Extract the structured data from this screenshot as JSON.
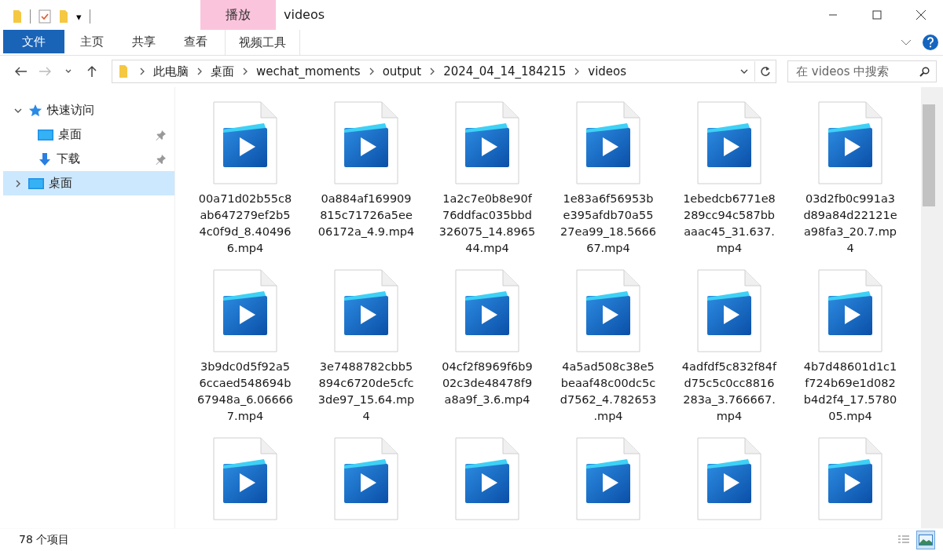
{
  "quick_access_toolbar": {
    "dropdown": "▾"
  },
  "title": "videos",
  "context_tab": {
    "group": "播放",
    "label": "视频工具"
  },
  "ribbon_tabs": [
    {
      "label": "文件",
      "selected": true,
      "kind": "file"
    },
    {
      "label": "主页",
      "selected": false,
      "kind": "tab"
    },
    {
      "label": "共享",
      "selected": false,
      "kind": "tab"
    },
    {
      "label": "查看",
      "selected": false,
      "kind": "tab"
    }
  ],
  "address": {
    "path": [
      "此电脑",
      "桌面",
      "wechat_moments",
      "output",
      "2024_04_14_184215",
      "videos"
    ]
  },
  "search": {
    "placeholder": "在 videos 中搜索"
  },
  "sidebar": {
    "items": [
      {
        "label": "快速访问",
        "kind": "quick_access",
        "expanded": true,
        "selected": false,
        "children": [
          {
            "label": "桌面",
            "kind": "desktop",
            "pinned": true,
            "selected": false
          },
          {
            "label": "下载",
            "kind": "download",
            "pinned": true,
            "selected": false
          }
        ]
      },
      {
        "label": "桌面",
        "kind": "desktop",
        "expanded": false,
        "selected": true
      }
    ]
  },
  "files": [
    {
      "kind": "labeled",
      "name_lines": [
        "00a71d02b55c8",
        "ab647279ef2b5",
        "4c0f9d_8.40496",
        "6.mp4"
      ]
    },
    {
      "kind": "labeled",
      "name_lines": [
        "0a884af169909",
        "815c71726a5ee",
        "06172a_4.9.mp4"
      ]
    },
    {
      "kind": "labeled",
      "name_lines": [
        "1a2c7e0b8e90f",
        "76ddfac035bbd",
        "326075_14.8965",
        "44.mp4"
      ]
    },
    {
      "kind": "labeled",
      "name_lines": [
        "1e83a6f56953b",
        "e395afdb70a55",
        "27ea99_18.5666",
        "67.mp4"
      ]
    },
    {
      "kind": "labeled",
      "name_lines": [
        "1ebedcb6771e8",
        "289cc94c587bb",
        "aaac45_31.637.",
        "mp4"
      ]
    },
    {
      "kind": "labeled",
      "name_lines": [
        "03d2fb0c991a3",
        "d89a84d22121e",
        "a98fa3_20.7.mp",
        "4"
      ]
    },
    {
      "kind": "labeled",
      "name_lines": [
        "3b9dc0d5f92a5",
        "6ccaed548694b",
        "67948a_6.06666",
        "7.mp4"
      ]
    },
    {
      "kind": "labeled",
      "name_lines": [
        "3e7488782cbb5",
        "894c6720de5cfc",
        "3de97_15.64.mp",
        "4"
      ]
    },
    {
      "kind": "labeled",
      "name_lines": [
        "04cf2f8969f6b9",
        "02c3de48478f9",
        "a8a9f_3.6.mp4"
      ]
    },
    {
      "kind": "labeled",
      "name_lines": [
        "4a5ad508c38e5",
        "beaaf48c00dc5c",
        "d7562_4.782653",
        ".mp4"
      ]
    },
    {
      "kind": "labeled",
      "name_lines": [
        "4adfdf5c832f84f",
        "d75c5c0cc8816",
        "283a_3.766667.",
        "mp4"
      ]
    },
    {
      "kind": "labeled",
      "name_lines": [
        "4b7d48601d1c1",
        "f724b69e1d082",
        "b4d2f4_17.5780",
        "05.mp4"
      ]
    },
    {
      "kind": "icon_only"
    },
    {
      "kind": "icon_only"
    },
    {
      "kind": "icon_only"
    },
    {
      "kind": "icon_only"
    },
    {
      "kind": "icon_only"
    },
    {
      "kind": "icon_only"
    }
  ],
  "status_bar": {
    "count": "78 个项目",
    "view_buttons": [
      {
        "kind": "details",
        "selected": false
      },
      {
        "kind": "large_icons",
        "selected": true
      }
    ]
  }
}
